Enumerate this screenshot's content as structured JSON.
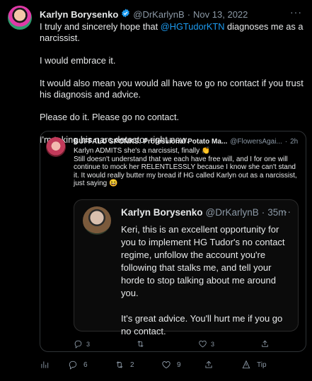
{
  "tweet": {
    "author_name": "Karlyn Borysenko",
    "verified_icon": "verified-badge-icon",
    "handle": "@DrKarlynB",
    "separator": "·",
    "date": "Nov 13, 2022",
    "more_icon": "more-dots-icon",
    "text_pre": "I truly and sincerely hope that ",
    "mention": "@HGTudorKTN",
    "text_post": " diagnoses me as a narcissist.",
    "para2": "I would embrace it.",
    "para3": "It would also mean you would all have to go no contact if you trust his diagnosis and advice.",
    "para4": "Please do it. Please go no contact.",
    "para5": "I'm taking his narc detector right now."
  },
  "quote": {
    "author_name": "BUFFALO SPONKS: Professional Potato Ma...",
    "handle": "@FlowersAgai...",
    "separator": "·",
    "time": "2h",
    "line1": "Karlyn ADMITS she's a narcissist, finally ",
    "line1_emoji": "👏",
    "line2": "Still doesn't understand that we each have free will, and I for one will continue to mock her RELENTLESSLY because I know she can't stand it. It would really butter my bread if HG called Karlyn out as a narcissist, just saying ",
    "line2_emoji": "😆",
    "inner": {
      "author_name": "Karlyn Borysenko",
      "handle": "@DrKarlynB",
      "separator": "·",
      "time": "35m",
      "para1": "Keri, this is an excellent opportunity for you to implement HG Tudor's no contact regime, unfollow the account you're following that stalks me, and tell your horde to stop talking about me around you.",
      "para2": "It's great advice. You'll hurt me if you go no contact."
    },
    "actions": {
      "replies": "3",
      "retweets": "",
      "likes": "3"
    }
  },
  "actions": {
    "replies": "6",
    "retweets": "2",
    "likes": "9",
    "tip_label": "Tip"
  },
  "colors": {
    "background": "#000000",
    "text": "#e7e9ea",
    "muted": "#8b98a5",
    "link": "#1d9bf0",
    "border": "#2f3336"
  }
}
